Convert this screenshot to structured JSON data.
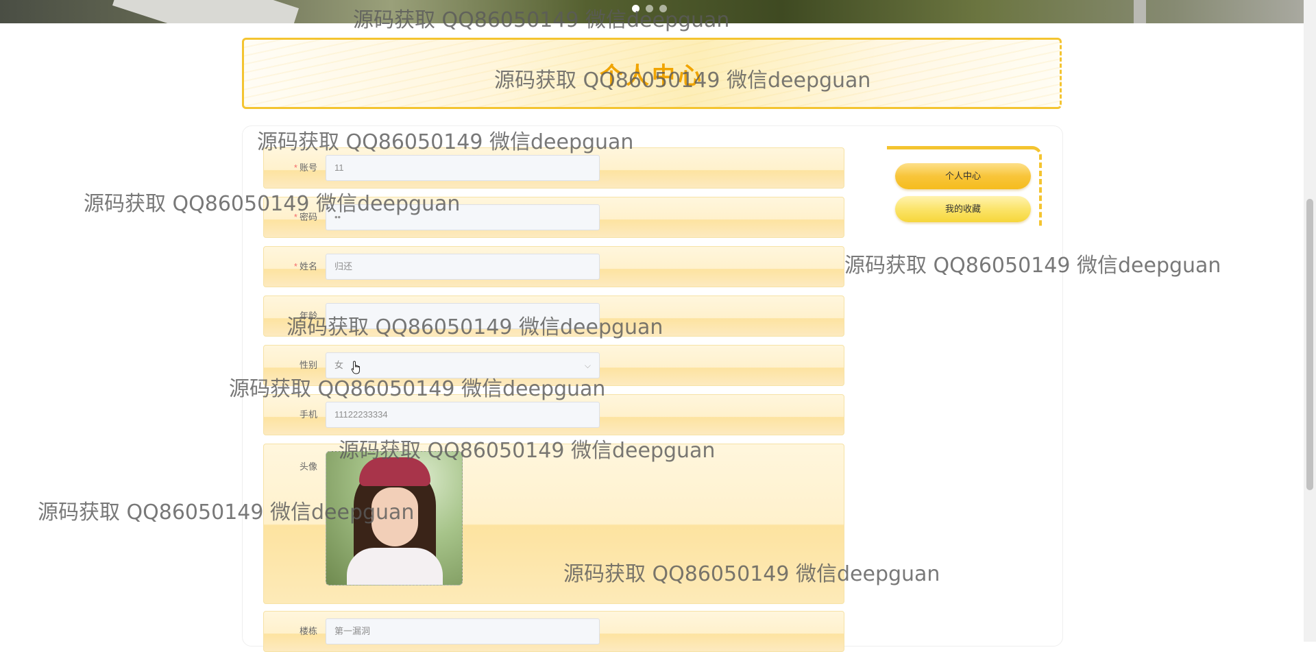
{
  "banner": {
    "slide_count": 3,
    "active_slide": 1
  },
  "page_title": "个人中心",
  "form": {
    "fields": [
      {
        "label": "账号",
        "required": true,
        "value": "11"
      },
      {
        "label": "密码",
        "required": true,
        "value": "••"
      },
      {
        "label": "姓名",
        "required": true,
        "value": "归还"
      },
      {
        "label": "年龄",
        "required": false,
        "value": ""
      },
      {
        "label": "性别",
        "required": false,
        "value": "女"
      },
      {
        "label": "手机",
        "required": false,
        "value": "11122233334"
      },
      {
        "label": "头像",
        "required": false,
        "value": ""
      },
      {
        "label": "楼栋",
        "required": false,
        "value": "第一漏洞"
      }
    ]
  },
  "sidebar": {
    "items": [
      {
        "label": "个人中心"
      },
      {
        "label": "我的收藏"
      }
    ]
  },
  "watermark": "源码获取 QQ86050149 微信deepguan",
  "colors": {
    "accent": "#f4c430",
    "title": "#f0a400",
    "required_star": "#f56c6c"
  }
}
